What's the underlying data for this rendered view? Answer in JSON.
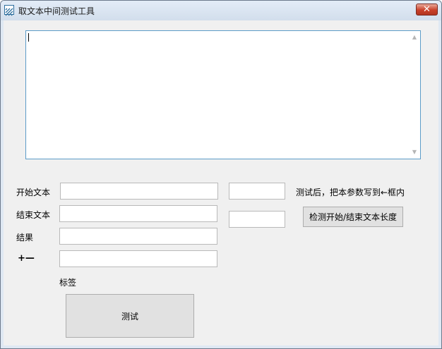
{
  "window": {
    "title": "取文本中间测试工具",
    "close_glyph": "✕",
    "app_icon": "striped-app-icon"
  },
  "form": {
    "start_text_label": "开始文本",
    "end_text_label": "结束文本",
    "result_label": "结果",
    "plus_minus_label": "+—",
    "start_text_value": "",
    "end_text_value": "",
    "result_value": "",
    "plus_minus_value": "",
    "start_length_value": "",
    "end_length_value": "",
    "hint_text": "测试后，把本参数写到←框内",
    "check_length_button": "检测开始/结束文本长度",
    "tag_label": "标签",
    "test_button": "测试"
  },
  "main_textarea": {
    "value": ""
  },
  "colors": {
    "close_button": "#c9412a",
    "textarea_border": "#5c9cc8",
    "window_background": "#f0f0f0"
  }
}
